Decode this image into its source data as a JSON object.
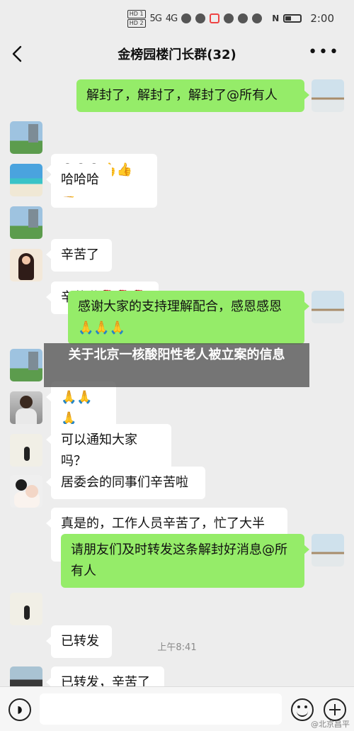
{
  "status_bar": {
    "hd1": "HD 1",
    "hd2": "HD 2",
    "signal1": "5G",
    "signal2": "4G",
    "nfc_icon": "N",
    "time": "2:00"
  },
  "header": {
    "back_icon": "chevron-left-icon",
    "title": "金榜园楼门长群(32)",
    "more_icon": "more-icon",
    "more_glyph": "•••"
  },
  "messages": [
    {
      "side": "out",
      "text": "解封了，解封了，解封了@所有人"
    },
    {
      "side": "in",
      "text": "😁😁😁👍👍👍"
    },
    {
      "side": "in",
      "text": "哈哈哈"
    },
    {
      "side": "in",
      "text": "辛苦了"
    },
    {
      "side": "in",
      "text": "辛苦啦🌹🌹🌹"
    },
    {
      "side": "out",
      "text": "感谢大家的支持理解配合，感恩感恩\n🙏🙏🙏"
    },
    {
      "side": "in",
      "text": "🙏🙏🙏"
    },
    {
      "side": "in",
      "text": "可以通知大家吗？"
    },
    {
      "side": "in",
      "text": "居委会的同事们辛苦啦"
    },
    {
      "side": "in",
      "text": "真是的，工作人员辛苦了，忙了大半\n夜，还好虚惊一场👍"
    },
    {
      "side": "out",
      "text": "请朋友们及时转发这条解封好消息@所\n有人"
    },
    {
      "side": "in",
      "text": "已转发"
    },
    {
      "side": "in",
      "text": "已转发，辛苦了"
    }
  ],
  "timestamp": "上午8:41",
  "overlay_caption": "关于北京一核酸阳性老人被立案的信息",
  "input_bar": {
    "voice_icon": "voice-icon",
    "voice_glyph": "◗",
    "emoji_icon": "emoji-icon",
    "plus_icon": "plus-icon"
  },
  "watermark": "@北京昌平"
}
